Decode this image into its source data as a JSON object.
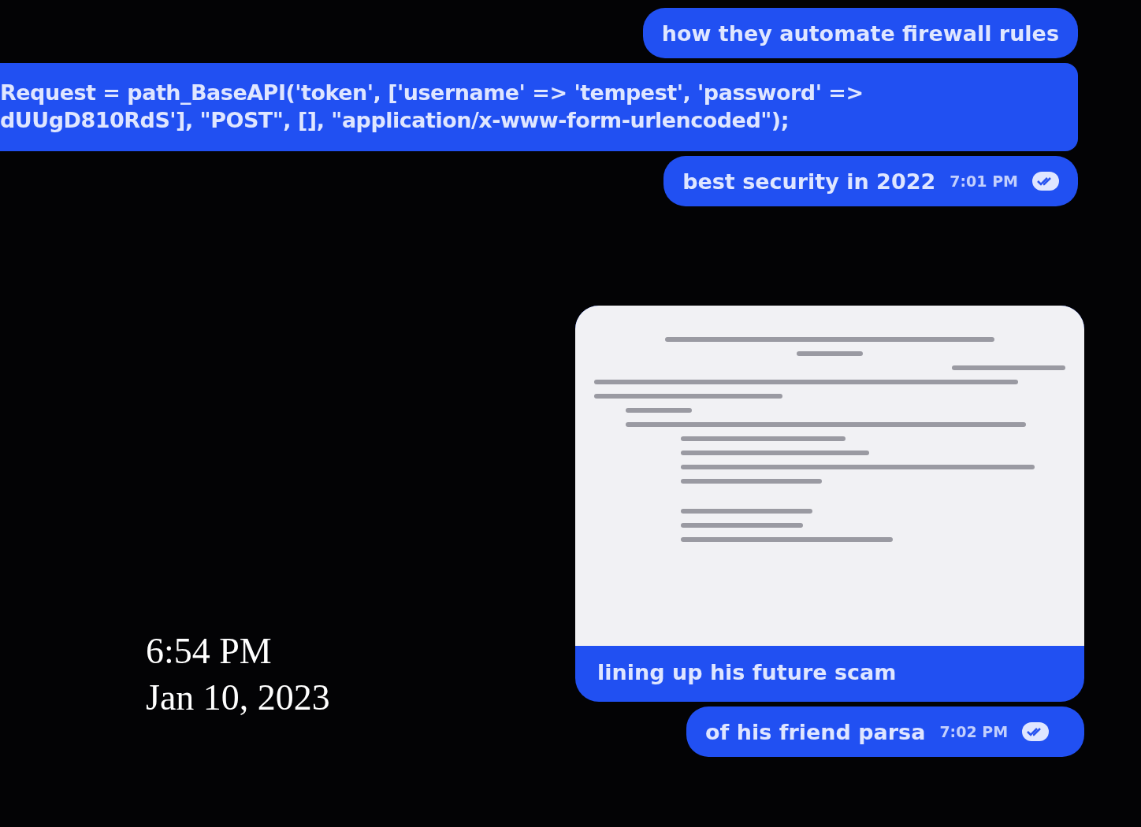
{
  "messages": [
    {
      "kind": "text",
      "text": "how they automate firewall rules"
    },
    {
      "kind": "code",
      "lines": [
        "Request = path_BaseAPI('token', ['username' => 'tempest', 'password' =>",
        "dUUgD810RdS'], \"POST\", [], \"application/x-www-form-urlencoded\");"
      ]
    },
    {
      "kind": "text",
      "text": "best security in 2022",
      "time": "7:01 PM"
    },
    {
      "kind": "image",
      "caption": "lining up his future scam"
    },
    {
      "kind": "text",
      "text": "of his friend parsa",
      "time": "7:02 PM"
    }
  ],
  "overlay": {
    "time": "6:54 PM",
    "date": "Jan 10, 2023"
  }
}
